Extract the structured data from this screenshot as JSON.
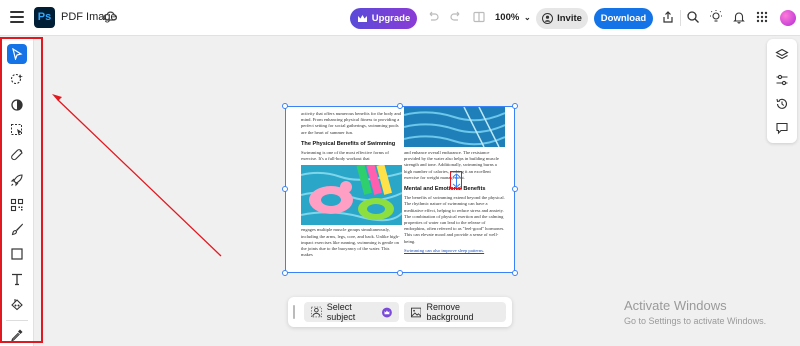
{
  "header": {
    "app_logo": "Ps",
    "title": "PDF Image",
    "upgrade_label": "Upgrade",
    "zoom": "100%",
    "invite_label": "Invite",
    "download_label": "Download"
  },
  "left_toolbar": {
    "tools": [
      "select-tool",
      "quick-select-tool",
      "adjust-tool",
      "crop-select-tool",
      "heal-tool",
      "rocket-tool",
      "qr-tool",
      "brush-tool",
      "shape-tool",
      "text-tool",
      "fill-tool",
      "eyedropper-tool"
    ]
  },
  "document": {
    "left_col_intro": "activity that offers numerous benefits for the body and mind. From enhancing physical fitness to providing a perfect setting for social gatherings, swimming pools are the heart of summer fun.",
    "left_heading": "The Physical Benefits of Swimming",
    "left_col_para": "Swimming is one of the most effective forms of exercise. It's a full-body workout that",
    "left_col_after": "engages multiple muscle groups simultaneously, including the arms, legs, core, and back. Unlike high-impact exercises like running, swimming is gentle on the joints due to the buoyancy of the water. This makes",
    "right_col_intro": "and enhance overall endurance. The resistance provided by the water also helps in building muscle strength and tone. Additionally, swimming burns a high number of calories, making it an excellent exercise for weight management.",
    "right_heading": "Mental and Emotional Benefits",
    "right_col_para": "The benefits of swimming extend beyond the physical. The rhythmic nature of swimming can have a meditative effect, helping to reduce stress and anxiety. The combination of physical exertion and the calming properties of water can lead to the release of endorphins, often referred to as \"feel-good\" hormones. This can elevate mood and provide a sense of well-being.",
    "right_col_last": "Swimming can also improve sleep patterns."
  },
  "bottom_bar": {
    "select_subject_label": "Select subject",
    "remove_background_label": "Remove background"
  },
  "watermark": {
    "line1": "Activate Windows",
    "line2": "Go to Settings to activate Windows."
  },
  "colors": {
    "accent": "#1473e6",
    "annotation_red": "#e0181f",
    "upgrade_gradient_start": "#5a4bd8",
    "upgrade_gradient_end": "#8a3bd6"
  }
}
